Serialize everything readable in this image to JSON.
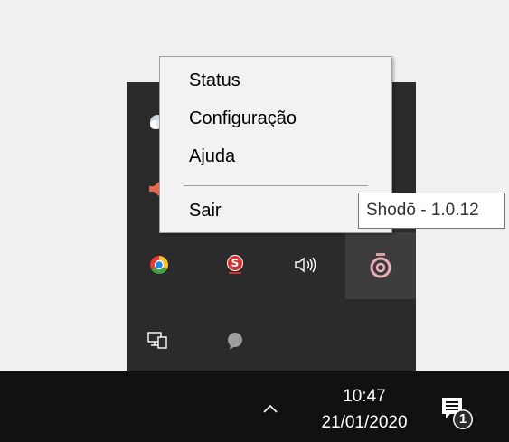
{
  "context_menu": {
    "items": [
      {
        "label": "Status"
      },
      {
        "label": "Configuração"
      },
      {
        "label": "Ajuda"
      },
      {
        "label": "Sair"
      }
    ]
  },
  "tooltip": {
    "text": "Shodō - 1.0.12"
  },
  "tray": {
    "icons": [
      {
        "name": "cloud-icon"
      },
      {
        "name": "speaker-muted-icon"
      },
      {
        "name": "chrome-icon"
      },
      {
        "name": "s-app-icon"
      },
      {
        "name": "volume-icon"
      },
      {
        "name": "shodo-icon"
      },
      {
        "name": "network-icon"
      },
      {
        "name": "chat-icon"
      }
    ]
  },
  "taskbar": {
    "time": "10:47",
    "date": "21/01/2020",
    "notification_count": "1"
  },
  "colors": {
    "tray_background": "#2b2b2b",
    "taskbar_background": "#111111",
    "menu_background": "#f2f2f2",
    "shodo_accent": "#8a2e3a"
  }
}
